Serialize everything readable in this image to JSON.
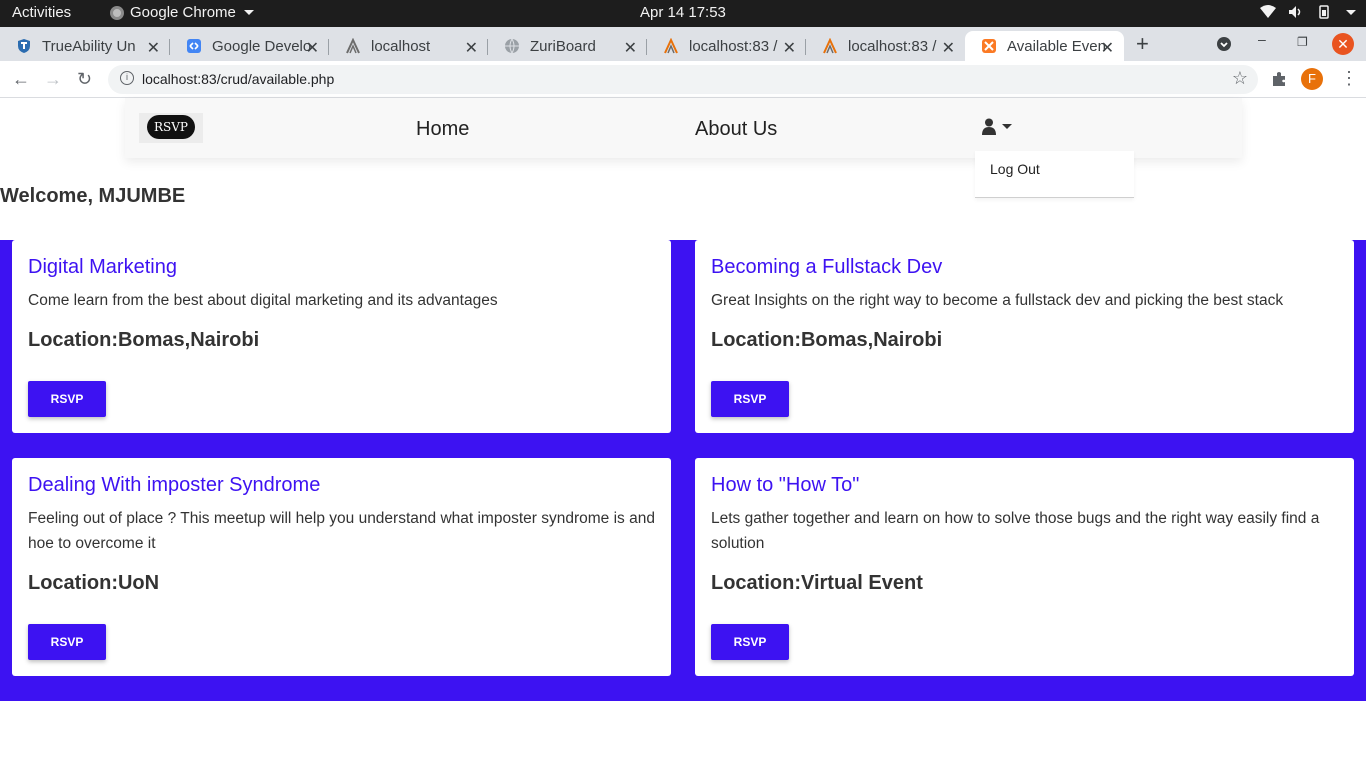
{
  "os": {
    "activities": "Activities",
    "app_name": "Google Chrome",
    "clock": "Apr 14  17:53"
  },
  "tabs": [
    {
      "title": "TrueAbility Un",
      "icon": "trueability-icon"
    },
    {
      "title": "Google Develo",
      "icon": "google-developers-icon"
    },
    {
      "title": "localhost",
      "icon": "phpmyadmin-icon"
    },
    {
      "title": "ZuriBoard",
      "icon": "globe-icon"
    },
    {
      "title": "localhost:83 /",
      "icon": "phpmyadmin-icon"
    },
    {
      "title": "localhost:83 /",
      "icon": "phpmyadmin-icon"
    },
    {
      "title": "Available Even",
      "icon": "xampp-icon"
    }
  ],
  "browser": {
    "url": "localhost:83/crud/available.php",
    "profile_initial": "F"
  },
  "site": {
    "logo_text": "RSVP",
    "nav": {
      "home": "Home",
      "about": "About Us"
    },
    "dropdown": {
      "logout": "Log Out"
    },
    "welcome": "Welcome, MJUMBE"
  },
  "events": [
    {
      "title": "Digital Marketing",
      "description": "Come learn from the best about digital marketing and its advantages",
      "location": "Location:Bomas,Nairobi",
      "button": "RSVP"
    },
    {
      "title": "Becoming a Fullstack Dev",
      "description": "Great Insights on the right way to become a fullstack dev and picking the best stack",
      "location": "Location:Bomas,Nairobi",
      "button": "RSVP"
    },
    {
      "title": "Dealing With imposter Syndrome",
      "description": "Feeling out of place ? This meetup will help you understand what imposter syndrome is and hoe to overcome it",
      "location": "Location:UoN",
      "button": "RSVP"
    },
    {
      "title": "How to \"How To\"",
      "description": "Lets gather together and learn on how to solve those bugs and the right way easily find a solution",
      "location": "Location:Virtual Event",
      "button": "RSVP"
    }
  ],
  "colors": {
    "accent": "#3d12f2",
    "topbar": "#1d1d1d",
    "tabstrip": "#dee1e6"
  }
}
